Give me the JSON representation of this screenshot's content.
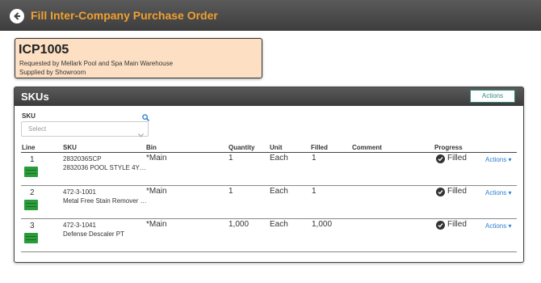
{
  "header": {
    "title": "Fill Inter-Company Purchase Order",
    "back_icon": "back-arrow-circle-icon"
  },
  "order": {
    "id": "ICP1005",
    "requested_by": "Requested by Mellark Pool and Spa Main Warehouse",
    "supplied_by": "Supplied by Showroom"
  },
  "skus_panel": {
    "title": "SKUs",
    "actions_label": "Actions",
    "sku_filter": {
      "label": "SKU",
      "placeholder": "Select"
    },
    "columns": [
      "Line",
      "SKU",
      "Bin",
      "Quantity",
      "Unit",
      "Filled",
      "Comment",
      "Progress"
    ],
    "rows": [
      {
        "line": "1",
        "sku": "2832036SCP",
        "description": "2832036 POOL STYLE 4Y…",
        "bin": "*Main",
        "quantity": "1",
        "unit": "Each",
        "filled": "1",
        "comment": "",
        "progress": "Filled",
        "actions": "Actions ▾"
      },
      {
        "line": "2",
        "sku": "472-3-1001",
        "description": "Metal Free Stain Remover …",
        "bin": "*Main",
        "quantity": "1",
        "unit": "Each",
        "filled": "1",
        "comment": "",
        "progress": "Filled",
        "actions": "Actions ▾"
      },
      {
        "line": "3",
        "sku": "472-3-1041",
        "description": "Defense Descaler PT",
        "bin": "*Main",
        "quantity": "1,000",
        "unit": "Each",
        "filled": "1,000",
        "comment": "",
        "progress": "Filled",
        "actions": "Actions ▾"
      }
    ]
  },
  "colors": {
    "accent": "#f0a030",
    "link": "#2a7fd4",
    "card_bg": "#fde0c4",
    "badge": "#2a9d3a"
  }
}
